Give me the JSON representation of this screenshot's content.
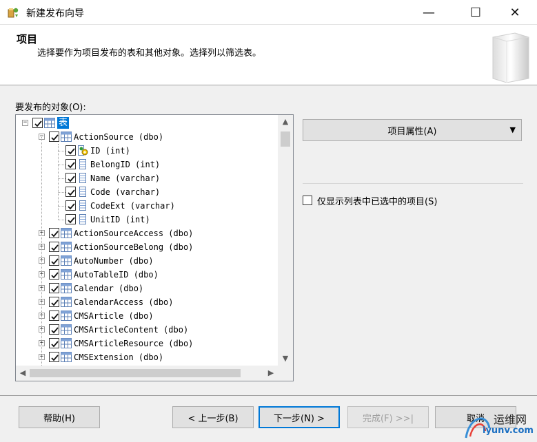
{
  "window": {
    "title": "新建发布向导",
    "minimize_glyph": "—",
    "maximize_glyph": "☐",
    "close_glyph": "✕"
  },
  "header": {
    "title": "项目",
    "subtitle": "选择要作为项目发布的表和其他对象。选择列以筛选表。"
  },
  "objects_label": "要发布的对象(O):",
  "tree": {
    "root": {
      "label": "表",
      "expanded": true,
      "checked": true
    },
    "expanded_table": {
      "label": "ActionSource (dbo)",
      "columns": [
        {
          "label": "ID (int)",
          "key": true
        },
        {
          "label": "BelongID (int)",
          "key": false
        },
        {
          "label": "Name (varchar)",
          "key": false
        },
        {
          "label": "Code (varchar)",
          "key": false
        },
        {
          "label": "CodeExt (varchar)",
          "key": false
        },
        {
          "label": "UnitID (int)",
          "key": false
        }
      ]
    },
    "tables": [
      "ActionSourceAccess (dbo)",
      "ActionSourceBelong (dbo)",
      "AutoNumber (dbo)",
      "AutoTableID (dbo)",
      "Calendar (dbo)",
      "CalendarAccess (dbo)",
      "CMSArticle (dbo)",
      "CMSArticleContent (dbo)",
      "CMSArticleResource (dbo)",
      "CMSExtension (dbo)"
    ]
  },
  "properties_dropdown": {
    "label": "项目属性(A)"
  },
  "only_selected_checkbox": {
    "label": "仅显示列表中已选中的项目(S)",
    "checked": false
  },
  "buttons": {
    "help": "帮助(H)",
    "back": "< 上一步(B)",
    "next": "下一步(N) >",
    "finish": "完成(F) >>|",
    "cancel": "取消"
  },
  "watermark": {
    "line1": "运维网",
    "line2": "iyunv.com"
  },
  "colors": {
    "selection": "#0078d7",
    "key_icon": "#f2c200"
  }
}
